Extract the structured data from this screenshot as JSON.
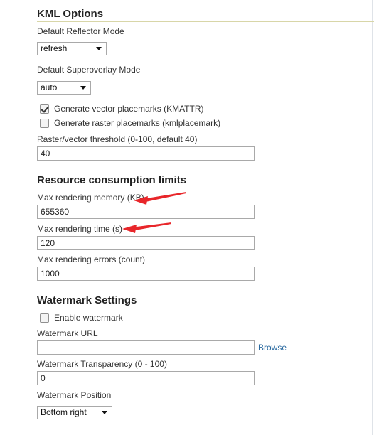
{
  "kml": {
    "title": "KML Options",
    "reflector_label": "Default Reflector Mode",
    "reflector_value": "refresh",
    "superoverlay_label": "Default Superoverlay Mode",
    "superoverlay_value": "auto",
    "vector_label": "Generate vector placemarks (KMATTR)",
    "vector_checked": true,
    "raster_label": "Generate raster placemarks (kmlplacemark)",
    "raster_checked": false,
    "threshold_label": "Raster/vector threshold (0-100, default 40)",
    "threshold_value": "40"
  },
  "limits": {
    "title": "Resource consumption limits",
    "memory_label": "Max rendering memory (KB)",
    "memory_value": "655360",
    "time_label": "Max rendering time (s)",
    "time_value": "120",
    "errors_label": "Max rendering errors (count)",
    "errors_value": "1000"
  },
  "watermark": {
    "title": "Watermark Settings",
    "enable_label": "Enable watermark",
    "enable_checked": false,
    "url_label": "Watermark URL",
    "url_value": "",
    "browse_label": "Browse",
    "transparency_label": "Watermark Transparency (0 - 100)",
    "transparency_value": "0",
    "position_label": "Watermark Position",
    "position_value": "Bottom right"
  },
  "colors": {
    "annotation_arrow": "#e8262a",
    "section_rule": "#d8d6a8",
    "link": "#2a6aa0"
  }
}
